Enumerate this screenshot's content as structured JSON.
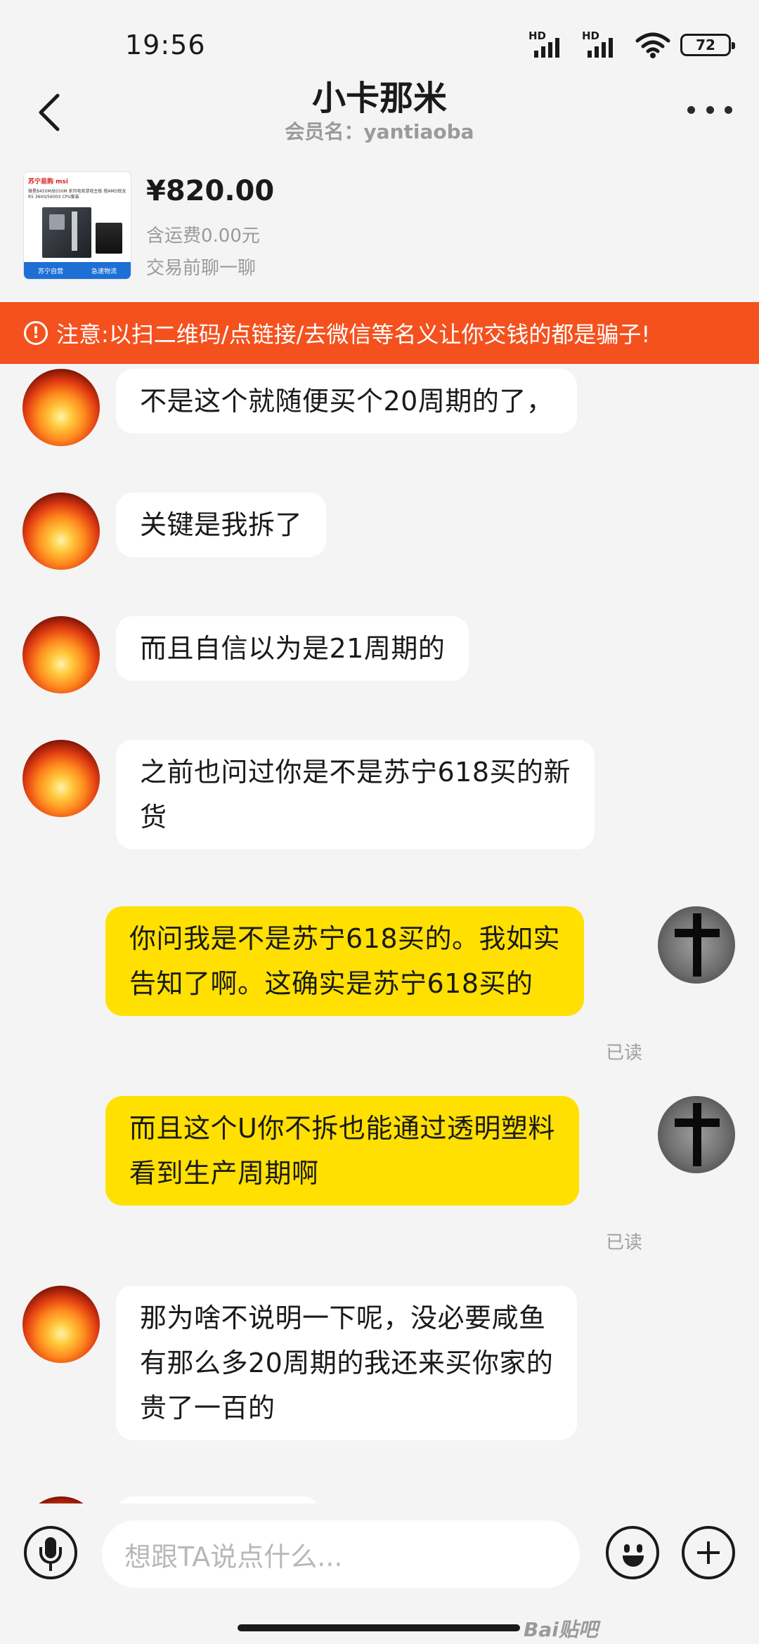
{
  "status_bar": {
    "time": "19:56",
    "signal_label": "HD",
    "battery": "72"
  },
  "header": {
    "title": "小卡那米",
    "member": "会员名：yantiaoba"
  },
  "product": {
    "price": "¥820.00",
    "shipping": "含运费0.00元",
    "hint": "交易前聊一聊",
    "thumb_brand": "苏宁易购 msi",
    "thumb_desc": "微星B450M/B550M 系列电竞游戏主板 搭AMD锐龙R5 3600/5600X CPU套装",
    "thumb_tag_left": "苏宁自营",
    "thumb_tag_right": "急速物流"
  },
  "warning": {
    "icon": "!",
    "text": "注意:以扫二维码/点链接/去微信等名义让你交钱的都是骗子!"
  },
  "messages": [
    {
      "side": "left",
      "lines": [
        "不是这个就随便买个20周期的了，"
      ]
    },
    {
      "side": "left",
      "lines": [
        "关键是我拆了"
      ]
    },
    {
      "side": "left",
      "lines": [
        "而且自信以为是21周期的"
      ]
    },
    {
      "side": "left",
      "lines": [
        "之前也问过你是不是苏宁618买的新",
        "货"
      ]
    },
    {
      "side": "right",
      "lines": [
        "你问我是不是苏宁618买的。我如实",
        "告知了啊。这确实是苏宁618买的"
      ],
      "status": "已读"
    },
    {
      "side": "right",
      "lines": [
        "而且这个U你不拆也能通过透明塑料",
        "看到生产周期啊"
      ],
      "status": "已读"
    },
    {
      "side": "left",
      "lines": [
        "那为啥不说明一下呢，没必要咸鱼",
        "有那么多20周期的我还来买你家的",
        "贵了一百的"
      ]
    }
  ],
  "input": {
    "placeholder": "想跟TA说点什么..."
  },
  "watermark": "Bai贴吧"
}
